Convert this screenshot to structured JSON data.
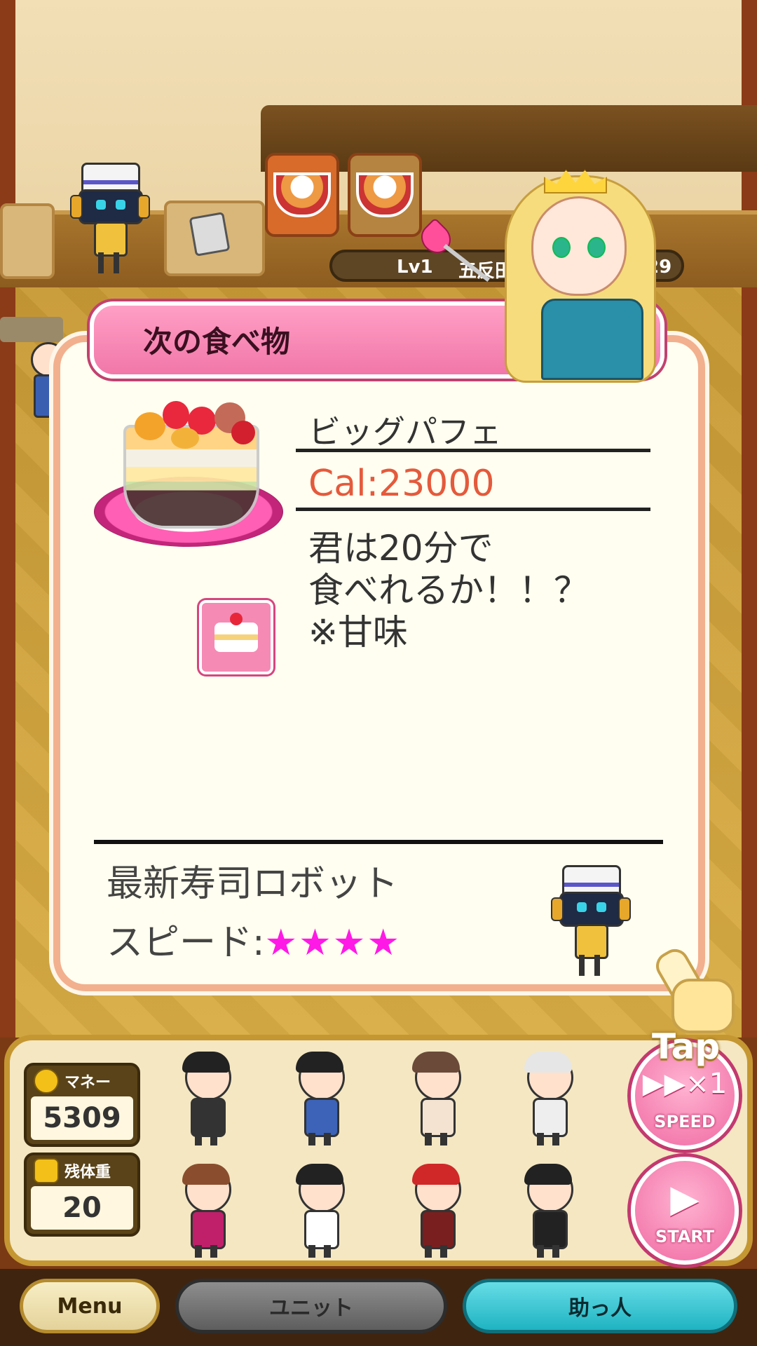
{
  "header": {
    "level_label": "Lv1",
    "level_partial_text": "五反田",
    "level_value": "29"
  },
  "modal": {
    "title": "次の食べ物",
    "food": {
      "name": "ビッグパフェ",
      "calories": "Cal:23000",
      "description_lines": [
        "君は20分で",
        "食べれるか！！？",
        "※甘味"
      ]
    },
    "unit": {
      "name": "最新寿司ロボット",
      "speed_label": "スピード:",
      "speed_stars": "★★★★"
    }
  },
  "tap_hint": "Tap",
  "bottom": {
    "money_label": "マネー",
    "money_value": "5309",
    "weight_label": "残体重",
    "weight_value": "20",
    "speed_button": {
      "glyph": "▶▶×1",
      "label": "SPEED"
    },
    "start_button": {
      "glyph": "▶",
      "label": "START"
    }
  },
  "nav": {
    "menu": "Menu",
    "unit": "ユニット",
    "helper": "助っ人"
  },
  "colors": {
    "accent_pink": "#f177a8",
    "calorie_red": "#e45a3c",
    "star_magenta": "#ff19e6",
    "helper_cyan": "#1fb3c2"
  }
}
